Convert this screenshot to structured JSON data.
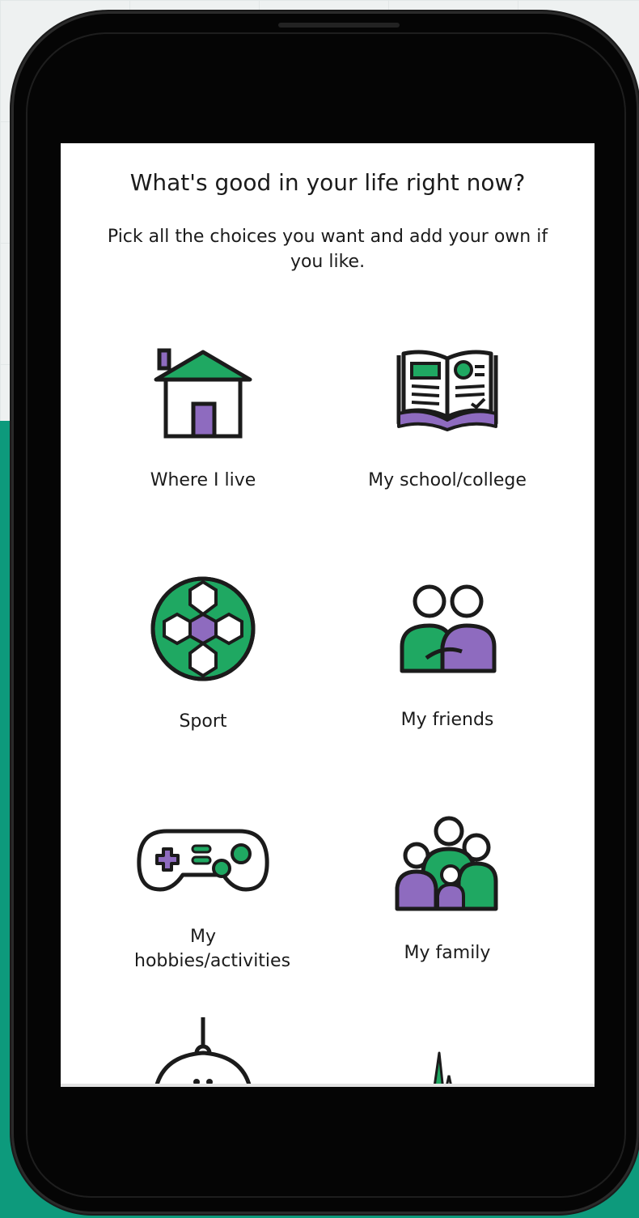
{
  "screen": {
    "title": "What's good in your life right now?",
    "subtitle": "Pick all the choices you want and add your own if you like."
  },
  "choices": [
    {
      "label": "Where I live",
      "icon": "house-icon"
    },
    {
      "label": "My school/college",
      "icon": "book-icon"
    },
    {
      "label": "Sport",
      "icon": "football-icon"
    },
    {
      "label": "My friends",
      "icon": "friends-icon"
    },
    {
      "label": "My hobbies/activities",
      "icon": "gamepad-icon"
    },
    {
      "label": "My family",
      "icon": "family-icon"
    },
    {
      "label": "",
      "icon": "pet-tag-icon"
    },
    {
      "label": "",
      "icon": "heartbeat-icon"
    }
  ],
  "colors": {
    "green": "#1fa862",
    "purple": "#8e6bbf",
    "outline": "#1b1b1b",
    "background_teal": "#0d9a7c"
  }
}
